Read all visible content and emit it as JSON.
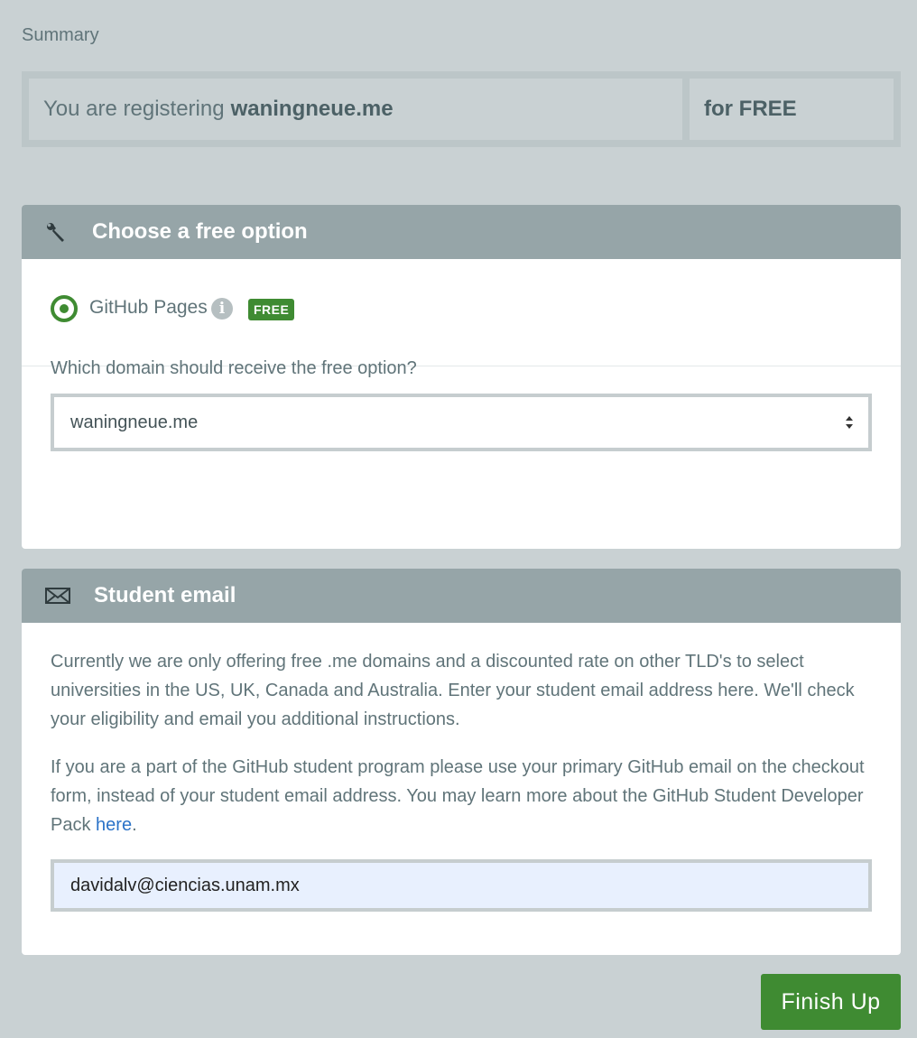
{
  "summary": {
    "label": "Summary",
    "registering_prefix": "You are registering",
    "domain": "waningneue.me",
    "price": "for FREE"
  },
  "free_option": {
    "title": "Choose a free option",
    "icon": "wrench-icon",
    "option_label": "GitHub Pages",
    "option_badge": "FREE",
    "option_selected": true,
    "domain_question": "Which domain should receive the free option?",
    "domain_select_value": "waningneue.me"
  },
  "student_email": {
    "title": "Student email",
    "icon": "envelope-icon",
    "paragraph1": "Currently we are only offering free .me domains and a discounted rate on other TLD's to select universities in the US, UK, Canada and Australia. Enter your student email address here. We'll check your eligibility and email you additional instructions.",
    "paragraph2_prefix": "If you are a part of the GitHub student program please use your primary GitHub email on the checkout form, instead of your student email address. You may learn more about the GitHub Student Developer Pack",
    "paragraph2_link": "here",
    "paragraph2_suffix": ".",
    "email_value": "davidalv@ciencias.unam.mx"
  },
  "actions": {
    "finish_label": "Finish Up"
  },
  "colors": {
    "page_bg": "#c9d1d3",
    "panel_header": "#96a5a8",
    "accent_green": "#3f8b32",
    "link_blue": "#2b73c8"
  }
}
